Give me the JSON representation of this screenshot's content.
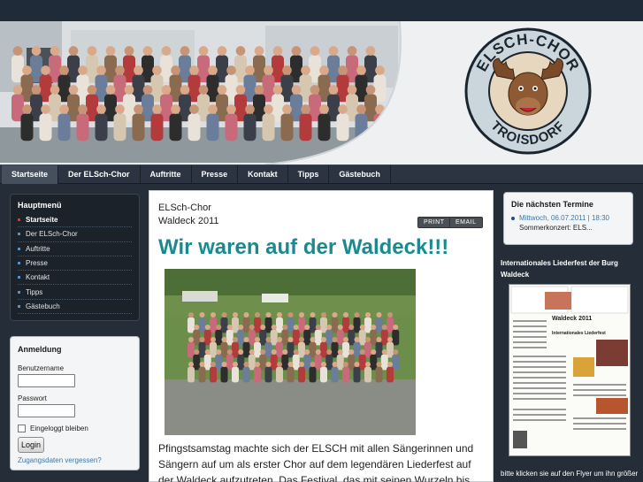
{
  "brand": {
    "logo_top_text": "ELSCH-CHOR",
    "logo_bottom_text": "TROISDORF"
  },
  "nav": {
    "items": [
      {
        "label": "Startseite",
        "active": true
      },
      {
        "label": "Der ELSch-Chor"
      },
      {
        "label": "Auftritte"
      },
      {
        "label": "Presse"
      },
      {
        "label": "Kontakt"
      },
      {
        "label": "Tipps"
      },
      {
        "label": "Gästebuch"
      }
    ]
  },
  "mainmenu": {
    "title": "Hauptmenü",
    "items": [
      {
        "label": "Startseite",
        "active": true
      },
      {
        "label": "Der ELSch-Chor"
      },
      {
        "label": "Auftritte"
      },
      {
        "label": "Presse"
      },
      {
        "label": "Kontakt"
      },
      {
        "label": "Tipps"
      },
      {
        "label": "Gästebuch"
      }
    ]
  },
  "login": {
    "title": "Anmeldung",
    "username_label": "Benutzername",
    "password_label": "Passwort",
    "remember_label": "Eingeloggt bleiben",
    "submit_label": "Login",
    "forgot_label": "Zugangsdaten vergessen?"
  },
  "article": {
    "breadcrumb": "ELSch-Chor",
    "subtitle": "Waldeck 2011",
    "print_label": "PRINT",
    "email_label": "EMAIL",
    "headline": "Wir waren auf der Waldeck!!!",
    "body": "Pfingstsamstag machte sich der ELSCH mit allen Sängerinnen und Sängern auf um als erster Chor auf dem legendären Liederfest auf der Waldeck aufzutreten. Das Festival, das mit seinen Wurzeln bis in die"
  },
  "termine": {
    "title": "Die nächsten Termine",
    "date": "Mittwoch, 06.07.2011 | 18:30",
    "event": "Sommerkonzert: ELS..."
  },
  "sidebar_fest": {
    "title": "Internationales Liederfest der Burg Waldeck",
    "caption": "bitte klicken sie auf den Flyer um ihn größer",
    "flyer_heading": "Waldeck 2011",
    "flyer_sub": "Internationales Liederfest"
  },
  "colors": {
    "accent_teal": "#1a8a8f",
    "link_blue": "#3d77a8",
    "nav_bg": "#2b3440",
    "page_bg": "#1d2a38"
  }
}
